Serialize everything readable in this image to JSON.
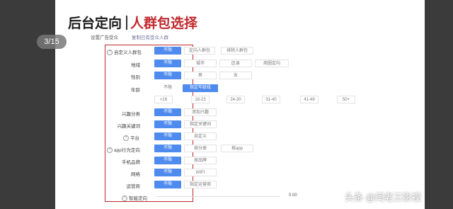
{
  "slide": {
    "title_main": "后台定向",
    "title_sub": "人群包选择",
    "pager": "3/15",
    "settings_label": "设置广告受众",
    "copy_link": "复制已有受众人群"
  },
  "rows": {
    "custom_audience": {
      "label": "自定义人群包",
      "options": [
        "不限",
        "定向人群包",
        "排除人群包"
      ]
    },
    "region": {
      "label": "地域",
      "options": [
        "不限",
        "城市",
        "区县",
        "商圈定向"
      ]
    },
    "gender": {
      "label": "性别",
      "options": [
        "不限",
        "男",
        "女"
      ]
    },
    "age": {
      "label": "年龄",
      "options": [
        "不限",
        "指定年龄段"
      ],
      "ranges": [
        "<18",
        "18-23",
        "24-30",
        "31-40",
        "41-49",
        "50+"
      ]
    },
    "interest": {
      "label": "兴趣分类",
      "options": [
        "不限",
        "添加兴趣"
      ]
    },
    "interest_keyword": {
      "label": "兴趣关键词",
      "options": [
        "不限",
        "指定关键词"
      ]
    },
    "platform": {
      "label": "平台",
      "options": [
        "不限",
        "自定义"
      ]
    },
    "app_behavior": {
      "label": "app行为定向",
      "options": [
        "不限",
        "按分类",
        "按app"
      ]
    },
    "phone_brand": {
      "label": "手机品牌",
      "options": [
        "不限",
        "按品牌"
      ]
    },
    "network": {
      "label": "网络",
      "options": [
        "不限",
        "WIFI"
      ]
    },
    "carrier": {
      "label": "运营商",
      "options": [
        "不限",
        "指定运营商"
      ]
    },
    "smart": {
      "label": "智能定向",
      "value": "0.00"
    }
  },
  "watermark": "头条 @闫老三影视",
  "colors": {
    "accent_blue": "#4f8bef",
    "highlight_red": "#c0282d"
  }
}
